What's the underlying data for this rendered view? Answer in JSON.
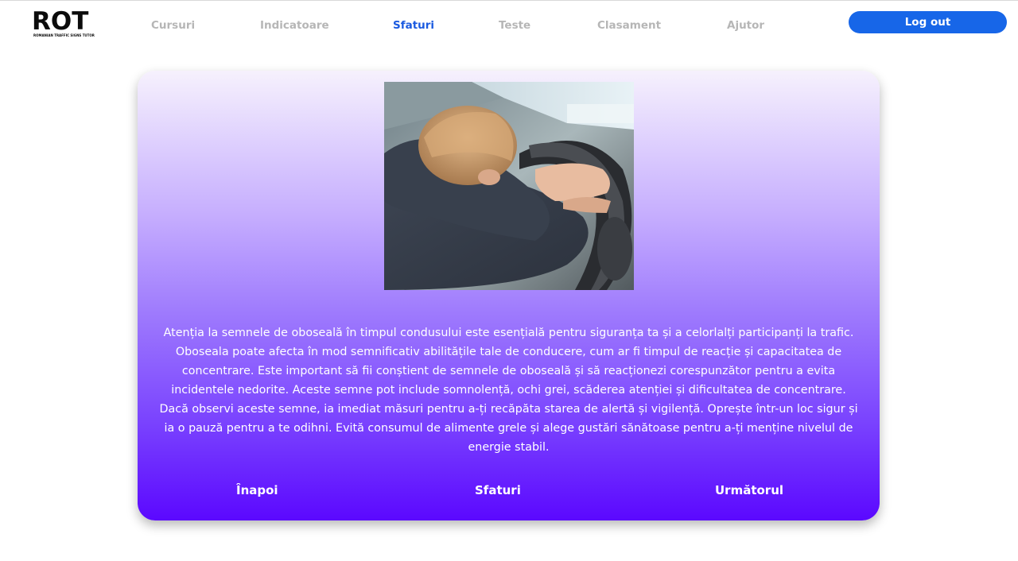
{
  "brand": {
    "logo_text": "ROT",
    "logo_subtitle": "ROMANIAN TRAFFIC SIGNS TUTOR"
  },
  "nav": {
    "items": [
      {
        "label": "Cursuri",
        "active": false
      },
      {
        "label": "Indicatoare",
        "active": false
      },
      {
        "label": "Sfaturi",
        "active": true
      },
      {
        "label": "Teste",
        "active": false
      },
      {
        "label": "Clasament",
        "active": false
      },
      {
        "label": "Ajutor",
        "active": false
      }
    ],
    "logout_label": "Log out"
  },
  "tip": {
    "image": "driver-asleep-on-steering-wheel-photo",
    "text": "Atenția la semnele de oboseală în timpul condusului este esențială pentru siguranța ta și a celorlalți participanți la trafic. Oboseala poate afecta în mod semnificativ abilitățile tale de conducere, cum ar fi timpul de reacție și capacitatea de concentrare. Este important să fii conștient de semnele de oboseală și să reacționezi corespunzător pentru a evita incidentele nedorite. Aceste semne pot include somnolență, ochi grei, scăderea atenției și dificultatea de concentrare. Dacă observi aceste semne, ia imediat măsuri pentru a-ți recăpăta starea de alertă și vigilență. Oprește într-un loc sigur și ia o pauză pentru a te odihni. Evită consumul de alimente grele și alege gustări sănătoase pentru a-ți menține nivelul de energie stabil."
  },
  "card_nav": {
    "back_label": "Înapoi",
    "section_label": "Sfaturi",
    "next_label": "Următorul"
  },
  "colors": {
    "accent": "#1766e8",
    "active_nav": "#1a5ae0",
    "inactive_nav": "#b6b6b6",
    "card_top": "#f6f1fd",
    "card_bottom": "#5b08ff"
  }
}
